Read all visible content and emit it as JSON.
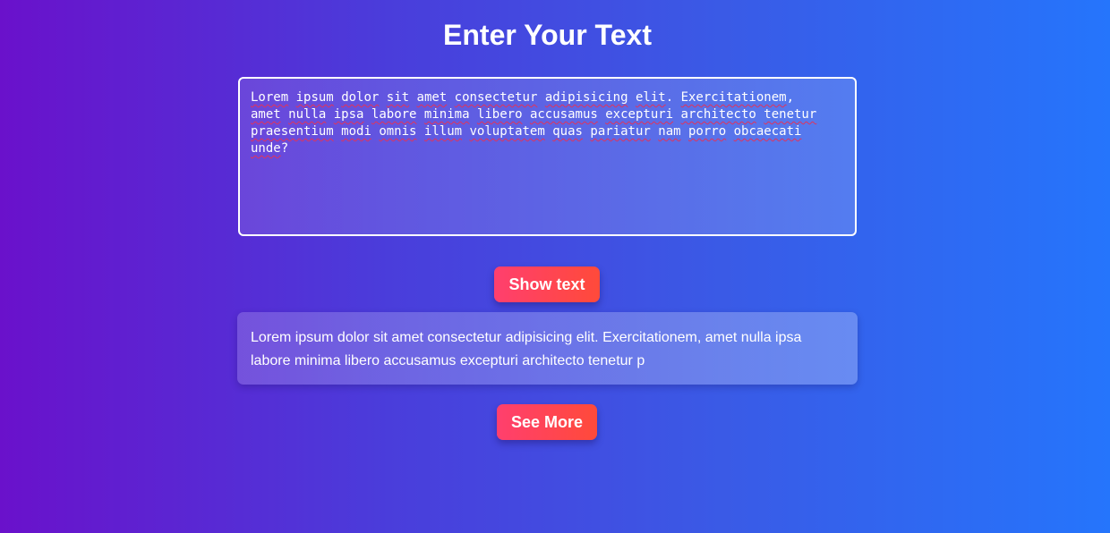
{
  "page": {
    "title": "Enter Your Text"
  },
  "input": {
    "text_lines": [
      "Lorem ipsum dolor sit amet consectetur adipisicing elit. Exercitationem,",
      "amet nulla ipsa labore minima libero accusamus excepturi architecto tenetur",
      "praesentium modi omnis illum voluptatem quas pariatur nam porro obcaecati",
      "unde?"
    ]
  },
  "buttons": {
    "show_text_label": "Show text",
    "see_more_label": "See More"
  },
  "output": {
    "text": "Lorem ipsum dolor sit amet consectetur adipisicing elit. Exercitationem, amet nulla ipsa labore minima libero accusamus excepturi architecto tenetur p"
  },
  "colors": {
    "background_start": "#6a11cb",
    "background_end": "#2575fc",
    "button_start": "#ff3f6e",
    "button_end": "#ff4a3a",
    "spellcheck_underline": "#e0335c"
  }
}
